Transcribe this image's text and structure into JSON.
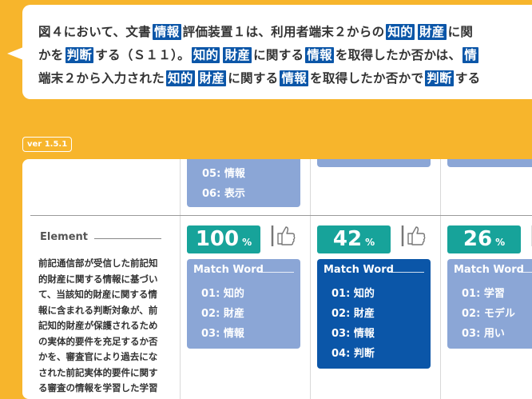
{
  "bubble": {
    "lines": [
      [
        {
          "t": "図４において、文書",
          "h": false
        },
        {
          "t": "情報",
          "h": true
        },
        {
          "t": "評価装置１は、利用者端末２からの",
          "h": false
        },
        {
          "t": "知的",
          "h": true
        },
        {
          "t": "財産",
          "h": true
        },
        {
          "t": "に関",
          "h": false
        }
      ],
      [
        {
          "t": "かを",
          "h": false
        },
        {
          "t": "判断",
          "h": true
        },
        {
          "t": "する（Ｓ１１）。",
          "h": false
        },
        {
          "t": "知的",
          "h": true
        },
        {
          "t": "財産",
          "h": true
        },
        {
          "t": "に関する",
          "h": false
        },
        {
          "t": "情報",
          "h": true
        },
        {
          "t": "を取得したか否かは、",
          "h": false
        },
        {
          "t": "情",
          "h": true
        }
      ],
      [
        {
          "t": "端末２から入力された",
          "h": false
        },
        {
          "t": "知的",
          "h": true
        },
        {
          "t": "財産",
          "h": true
        },
        {
          "t": "に関する",
          "h": false
        },
        {
          "t": "情報",
          "h": true
        },
        {
          "t": "を取得したか否かで",
          "h": false
        },
        {
          "t": "判断",
          "h": true
        },
        {
          "t": "する",
          "h": false
        }
      ]
    ]
  },
  "version": "ver 1.5.1",
  "prev_card": {
    "items": [
      "05: 情報",
      "06: 表示"
    ]
  },
  "element": {
    "label": "Element",
    "lines": [
      "前記通信部が受信した前記知",
      "的財産に関する情報に基づい",
      "て、当該知的財産に関する情",
      "報に含まれる判断対象が、前",
      "記知的財産が保護されるため",
      "の実体的要件を充足するか否",
      "かを、審査官により過去にな",
      "された前記実体的要件に関す",
      "る審査の情報を学習した学習"
    ]
  },
  "results": [
    {
      "percent": "100",
      "unit": "%",
      "match_title": "Match Word",
      "words": [
        "01: 知的",
        "02: 財産",
        "03: 情報"
      ],
      "selected": false
    },
    {
      "percent": "42",
      "unit": "%",
      "match_title": "Match Word",
      "words": [
        "01: 知的",
        "02: 財産",
        "03: 情報",
        "04: 判断"
      ],
      "selected": true
    },
    {
      "percent": "26",
      "unit": "%",
      "match_title": "Match Word",
      "words": [
        "01: 学習",
        "02: モデル",
        "03: 用い"
      ],
      "selected": false
    }
  ],
  "colors": {
    "background": "#f7b52c",
    "highlight": "#0b56a8",
    "percent_badge": "#17a39a",
    "card_light": "#8ba6d6",
    "card_selected": "#0b56a8"
  },
  "icons": [
    "thumbs-up-icon"
  ]
}
